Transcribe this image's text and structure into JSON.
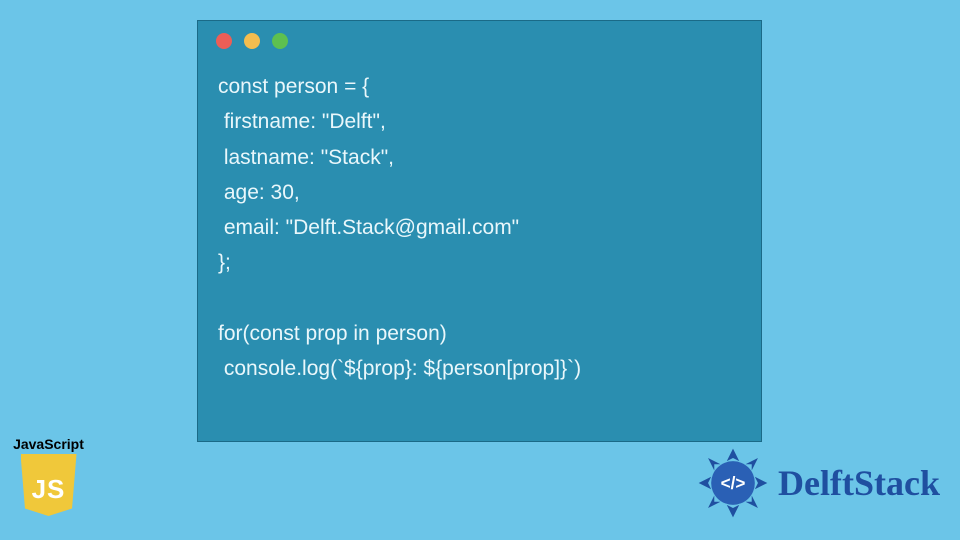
{
  "window": {
    "dots": [
      "red",
      "yellow",
      "green"
    ]
  },
  "code": {
    "line1": "const person = {",
    "line2": " firstname: \"Delft\",",
    "line3": " lastname: \"Stack\",",
    "line4": " age: 30,",
    "line5": " email: \"Delft.Stack@gmail.com\"",
    "line6": "};",
    "line7": "",
    "line8": "for(const prop in person)",
    "line9": " console.log(`${prop}: ${person[prop]}`)"
  },
  "badge": {
    "label": "JavaScript",
    "logo_text": "JS"
  },
  "brand": {
    "text": "DelftStack",
    "accent": "#1f4fa0"
  }
}
